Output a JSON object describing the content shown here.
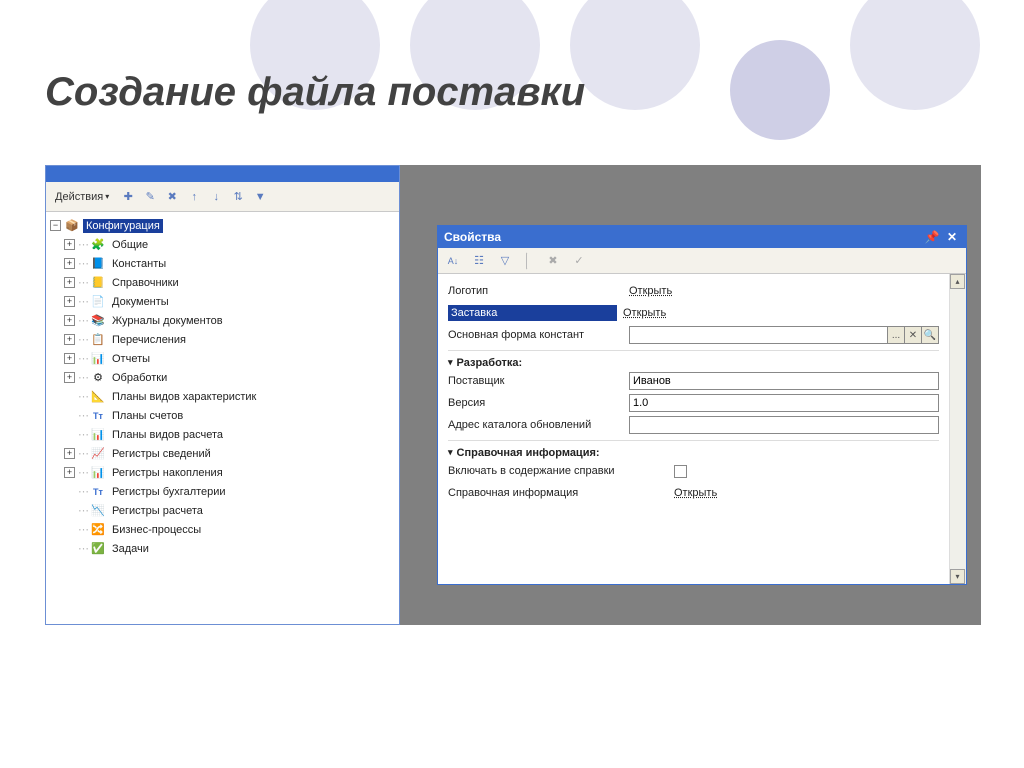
{
  "slide_title": "Создание файла поставки",
  "cfg_toolbar": {
    "actions_label": "Действия"
  },
  "tree": {
    "root": "Конфигурация",
    "items": [
      {
        "label": "Общие",
        "icon": "🔗",
        "expandable": true
      },
      {
        "label": "Константы",
        "icon": "📘",
        "expandable": true
      },
      {
        "label": "Справочники",
        "icon": "📒",
        "expandable": true
      },
      {
        "label": "Документы",
        "icon": "📄",
        "expandable": true
      },
      {
        "label": "Журналы документов",
        "icon": "📚",
        "expandable": true
      },
      {
        "label": "Перечисления",
        "icon": "📋",
        "expandable": true
      },
      {
        "label": "Отчеты",
        "icon": "📊",
        "expandable": true
      },
      {
        "label": "Обработки",
        "icon": "⚙",
        "expandable": true
      },
      {
        "label": "Планы видов характеристик",
        "icon": "📐",
        "expandable": false
      },
      {
        "label": "Планы счетов",
        "icon": "Тт",
        "expandable": false
      },
      {
        "label": "Планы видов расчета",
        "icon": "📊",
        "expandable": false
      },
      {
        "label": "Регистры сведений",
        "icon": "📈",
        "expandable": true
      },
      {
        "label": "Регистры накопления",
        "icon": "📊",
        "expandable": true
      },
      {
        "label": "Регистры бухгалтерии",
        "icon": "Тт",
        "expandable": false
      },
      {
        "label": "Регистры расчета",
        "icon": "📉",
        "expandable": false
      },
      {
        "label": "Бизнес-процессы",
        "icon": "🔀",
        "expandable": false
      },
      {
        "label": "Задачи",
        "icon": "✅",
        "expandable": false
      }
    ]
  },
  "props": {
    "title": "Свойства",
    "rows": {
      "logo_label": "Логотип",
      "logo_link": "Открыть",
      "splash_label": "Заставка",
      "splash_link": "Открыть",
      "mainform_label": "Основная форма констант",
      "mainform_btn": "...",
      "section_dev": "Разработка:",
      "vendor_label": "Поставщик",
      "vendor_value": "Иванов",
      "version_label": "Версия",
      "version_value": "1.0",
      "upd_label": "Адрес каталога обновлений",
      "upd_value": "",
      "section_help": "Справочная информация:",
      "include_label": "Включать в содержание справки",
      "helpinfo_label": "Справочная информация",
      "helpinfo_link": "Открыть"
    }
  }
}
